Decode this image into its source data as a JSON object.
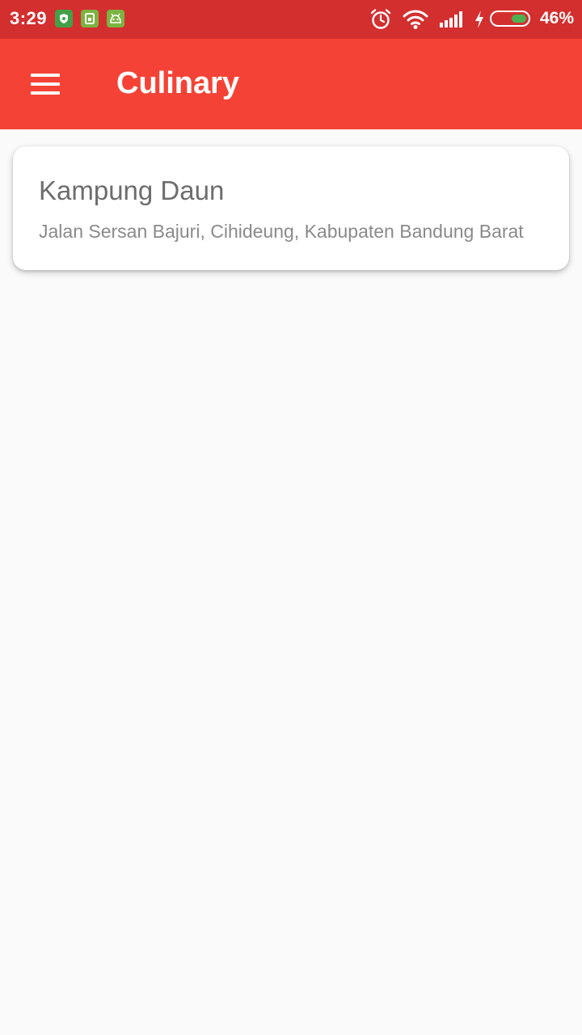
{
  "status_bar": {
    "time": "3:29",
    "battery_percent": "46%",
    "battery_level": 0.46,
    "notification_icons": [
      "shield-icon",
      "sim-card-icon",
      "android-robot-icon"
    ],
    "system_icons": [
      "alarm-clock-icon",
      "wifi-icon",
      "signal-icon",
      "charging-bolt-icon",
      "battery-icon"
    ],
    "colors": {
      "background": "#d32f2f",
      "battery_fill": "#4caf50"
    }
  },
  "app_bar": {
    "title": "Culinary",
    "menu_icon": "hamburger-menu-icon",
    "color": "#f44336"
  },
  "places": [
    {
      "name": "Kampung Daun",
      "address": "Jalan Sersan Bajuri, Cihideung, Kabupaten Bandung Barat"
    }
  ]
}
